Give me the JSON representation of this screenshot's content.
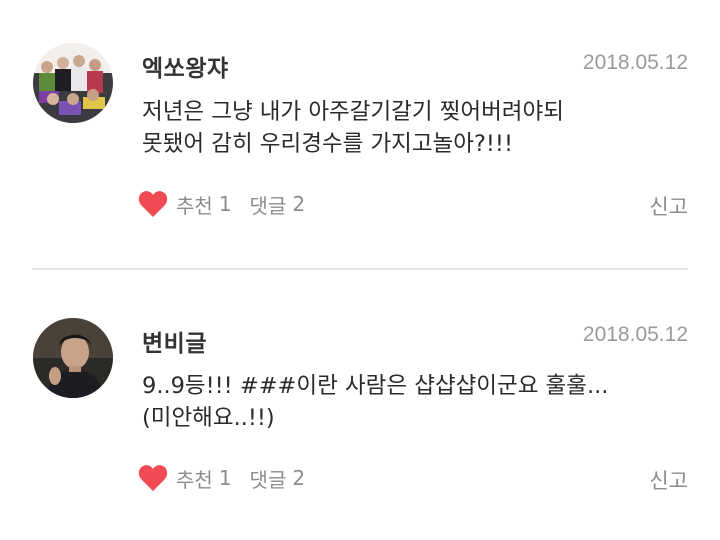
{
  "comments": [
    {
      "username": "엑쏘왕쟈",
      "date": "2018.05.12",
      "text_lines": [
        "저년은 그냥 내가 아주갈기갈기 찢어버려야되",
        "못됐어 감히 우리경수를 가지고놀아?!!!"
      ],
      "like_label": "추천",
      "like_count": "1",
      "reply_label": "댓글",
      "reply_count": "2",
      "report_label": "신고",
      "avatar_icon": "group-photo-avatar"
    },
    {
      "username": "변비글",
      "date": "2018.05.12",
      "text_lines": [
        "9..9등!!! ###이란 사람은 샵샵샵이군요 훌훌...",
        "(미안해요..!!)"
      ],
      "like_label": "추천",
      "like_count": "1",
      "reply_label": "댓글",
      "reply_count": "2",
      "report_label": "신고",
      "avatar_icon": "portrait-photo-avatar"
    }
  ],
  "colors": {
    "heart": "#f04b52",
    "muted_text": "#8c8c8c",
    "date_text": "#9a9a9a",
    "divider": "#e6e6e6"
  }
}
